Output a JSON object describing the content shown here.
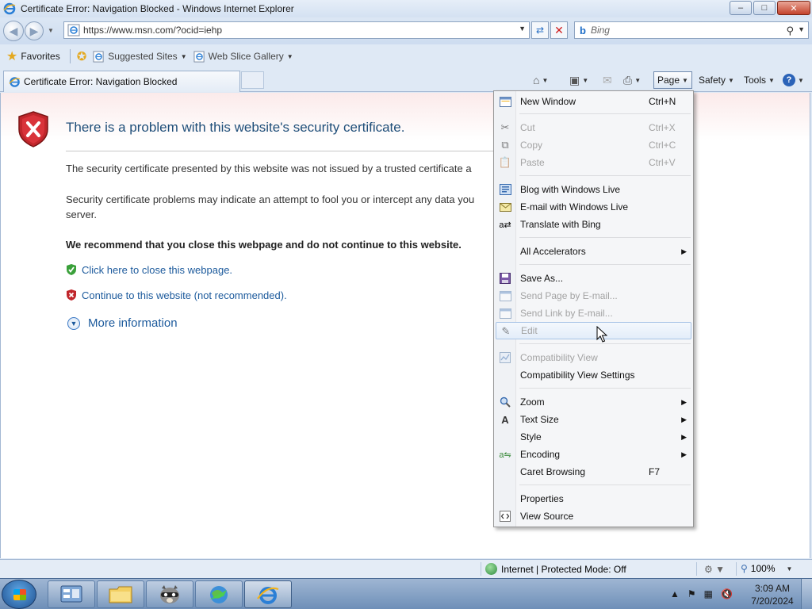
{
  "window": {
    "title": "Certificate Error: Navigation Blocked - Windows Internet Explorer",
    "minimize": "–",
    "maximize": "□",
    "close": "✕"
  },
  "address_bar": {
    "url": "https://www.msn.com/?ocid=iehp",
    "search_placeholder": "Bing",
    "search_provider_icon": "b"
  },
  "favorites_bar": {
    "favorites_label": "Favorites",
    "items": [
      {
        "label": "Suggested Sites"
      },
      {
        "label": "Web Slice Gallery"
      }
    ]
  },
  "tab": {
    "label": "Certificate Error: Navigation Blocked"
  },
  "command_bar": {
    "page": "Page",
    "safety": "Safety",
    "tools": "Tools",
    "help": "?"
  },
  "content": {
    "title": "There is a problem with this website's security certificate.",
    "para1": "The security certificate presented by this website was not issued by a trusted certificate a",
    "para2": "Security certificate problems may indicate an attempt to fool you or intercept any data you server.",
    "recommend": "We recommend that you close this webpage and do not continue to this website.",
    "close_link": "Click here to close this webpage.",
    "continue_link": "Continue to this website (not recommended).",
    "more_info": "More information"
  },
  "page_menu": {
    "items": [
      {
        "label": "New Window",
        "shortcut": "Ctrl+N",
        "icon": "new-window-icon"
      },
      {
        "label": "Cut",
        "shortcut": "Ctrl+X",
        "icon": "scissors-icon",
        "disabled": true
      },
      {
        "label": "Copy",
        "shortcut": "Ctrl+C",
        "icon": "copy-icon",
        "disabled": true
      },
      {
        "label": "Paste",
        "shortcut": "Ctrl+V",
        "icon": "paste-icon",
        "disabled": true
      },
      {
        "label": "Blog with Windows Live",
        "icon": "blog-icon"
      },
      {
        "label": "E-mail with Windows Live",
        "icon": "email-icon"
      },
      {
        "label": "Translate with Bing",
        "icon": "translate-icon"
      },
      {
        "label": "All Accelerators",
        "submenu": true
      },
      {
        "label": "Save As...",
        "icon": "save-icon"
      },
      {
        "label": "Send Page by E-mail...",
        "icon": "send-page-icon",
        "disabled": true
      },
      {
        "label": "Send Link by E-mail...",
        "icon": "send-link-icon",
        "disabled": true
      },
      {
        "label": "Edit",
        "icon": "pencil-icon",
        "disabled": true,
        "highlighted": true
      },
      {
        "label": "Compatibility View",
        "icon": "compat-icon",
        "disabled": true
      },
      {
        "label": "Compatibility View Settings"
      },
      {
        "label": "Zoom",
        "icon": "zoom-icon",
        "submenu": true
      },
      {
        "label": "Text Size",
        "icon": "text-size-icon",
        "submenu": true
      },
      {
        "label": "Style",
        "submenu": true
      },
      {
        "label": "Encoding",
        "icon": "encoding-icon",
        "submenu": true
      },
      {
        "label": "Caret Browsing",
        "shortcut": "F7"
      },
      {
        "label": "Properties"
      },
      {
        "label": "View Source",
        "icon": "view-source-icon"
      }
    ]
  },
  "status_bar": {
    "zone": "Internet | Protected Mode: Off",
    "zoom": "100%"
  },
  "taskbar": {
    "time": "3:09 AM",
    "date": "7/20/2024"
  },
  "colors": {
    "link": "#1c5a9c",
    "title_blue": "#1f4e79",
    "error_red": "#c0262b"
  }
}
